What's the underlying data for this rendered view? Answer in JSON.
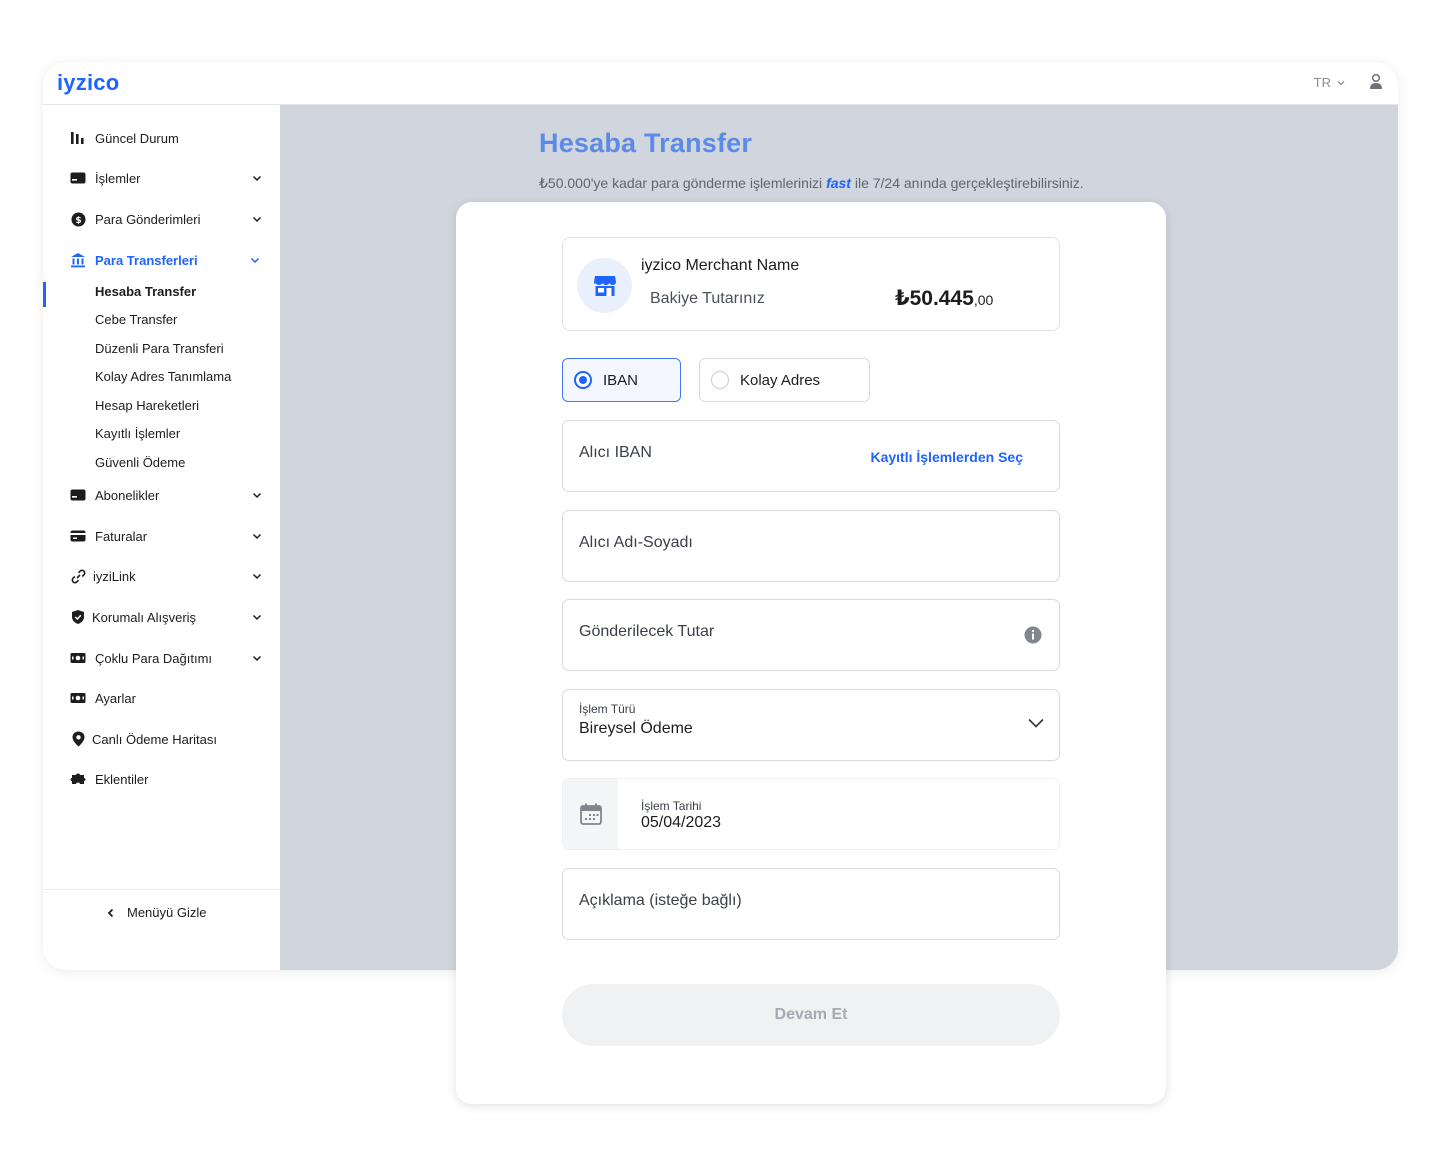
{
  "header": {
    "logo": "iyzico",
    "lang": "TR"
  },
  "sidebar": {
    "items": [
      {
        "label": "Güncel Durum"
      },
      {
        "label": "İşlemler"
      },
      {
        "label": "Para Gönderimleri"
      },
      {
        "label": "Para Transferleri"
      },
      {
        "label": "Abonelikler"
      },
      {
        "label": "Faturalar"
      },
      {
        "label": "iyziLink"
      },
      {
        "label": "Korumalı Alışveriş"
      },
      {
        "label": "Çoklu Para Dağıtımı"
      },
      {
        "label": "Ayarlar"
      },
      {
        "label": "Canlı Ödeme Haritası"
      },
      {
        "label": "Eklentiler"
      }
    ],
    "subitems": [
      "Hesaba Transfer",
      "Cebe Transfer",
      "Düzenli Para Transferi",
      "Kolay Adres Tanımlama",
      "Hesap Hareketleri",
      "Kayıtlı İşlemler",
      "Güvenli Ödeme"
    ],
    "hide_menu": "Menüyü Gizle"
  },
  "page": {
    "title": "Hesaba Transfer",
    "subtitle_pre": "₺50.000'ye kadar para gönderme işlemlerinizi ",
    "subtitle_fast": "fast",
    "subtitle_post": " ile 7/24 anında gerçekleştirebilirsiniz."
  },
  "merchant": {
    "name": "iyzico Merchant Name",
    "balance_label": "Bakiye Tutarınız",
    "balance_main": "₺50.445",
    "balance_cents": ",00"
  },
  "form": {
    "radio_iban": "IBAN",
    "radio_kolay": "Kolay Adres",
    "iban_placeholder": "Alıcı IBAN",
    "saved_link": "Kayıtlı İşlemlerden Seç",
    "name_placeholder": "Alıcı Adı-Soyadı",
    "amount_placeholder": "Gönderilecek Tutar",
    "type_label": "İşlem Türü",
    "type_value": "Bireysel Ödeme",
    "date_label": "İşlem Tarihi",
    "date_value": "05/04/2023",
    "desc_placeholder": "Açıklama (isteğe bağlı)",
    "submit": "Devam Et"
  },
  "colors": {
    "accent": "#1e64ff",
    "title": "#5b8be6",
    "background": "#d1d5dd"
  }
}
